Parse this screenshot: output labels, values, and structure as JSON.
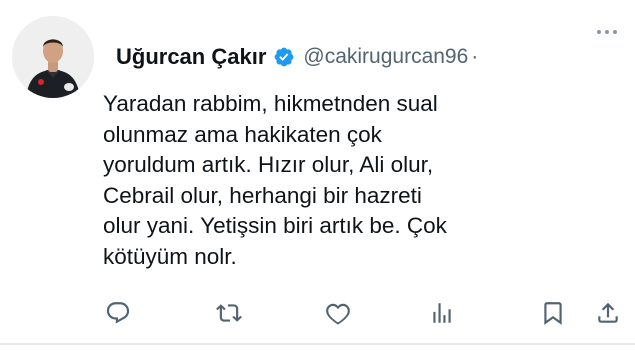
{
  "tweet": {
    "author": {
      "display_name": "Uğurcan Çakır",
      "handle": "@cakirugurcan96",
      "separator": "·",
      "verified": true,
      "verified_color": "#1d9bf0"
    },
    "text_lines": [
      "Yaradan rabbim, hikmetnden sual",
      "olunmaz ama hakikaten çok",
      "yoruldum artık. Hızır olur, Ali olur,",
      "Cebrail olur, herhangi bir hazreti",
      "olur yani. Yetişsin biri artık be. Çok",
      "kötüyüm nolr."
    ],
    "actions": [
      {
        "name": "reply",
        "icon": "reply-icon"
      },
      {
        "name": "retweet",
        "icon": "retweet-icon"
      },
      {
        "name": "like",
        "icon": "heart-icon"
      },
      {
        "name": "views",
        "icon": "views-icon"
      },
      {
        "name": "bookmark",
        "icon": "bookmark-icon"
      },
      {
        "name": "share",
        "icon": "share-icon"
      }
    ],
    "more_icon": "more-icon",
    "icon_color": "#536471"
  }
}
